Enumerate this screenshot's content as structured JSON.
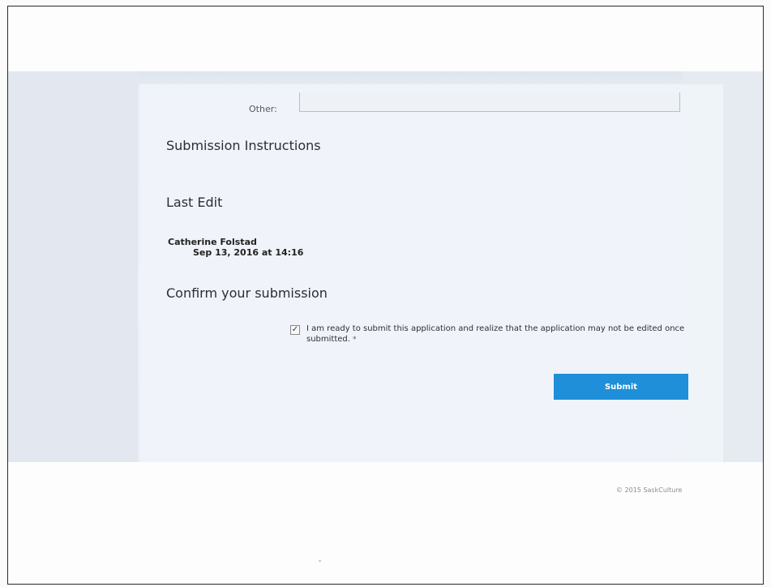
{
  "form": {
    "other_label": "Other:",
    "other_value": "",
    "submission_instructions_title": "Submission Instructions",
    "last_edit_title": "Last Edit",
    "editor_name": "Catherine Folstad",
    "edit_date": "Sep 13, 2016 at 14:16",
    "confirm_title": "Confirm your submission",
    "confirm_checkbox_checked": true,
    "confirm_text": "I am ready to submit this application and realize that the application may not be edited once submitted.",
    "required_marker": "*",
    "submit_label": "Submit"
  },
  "footer": {
    "copyright": "© 2015 SaskCulture"
  },
  "colors": {
    "submit_button": "#1e8fd8",
    "backdrop": "#e9eef5"
  }
}
